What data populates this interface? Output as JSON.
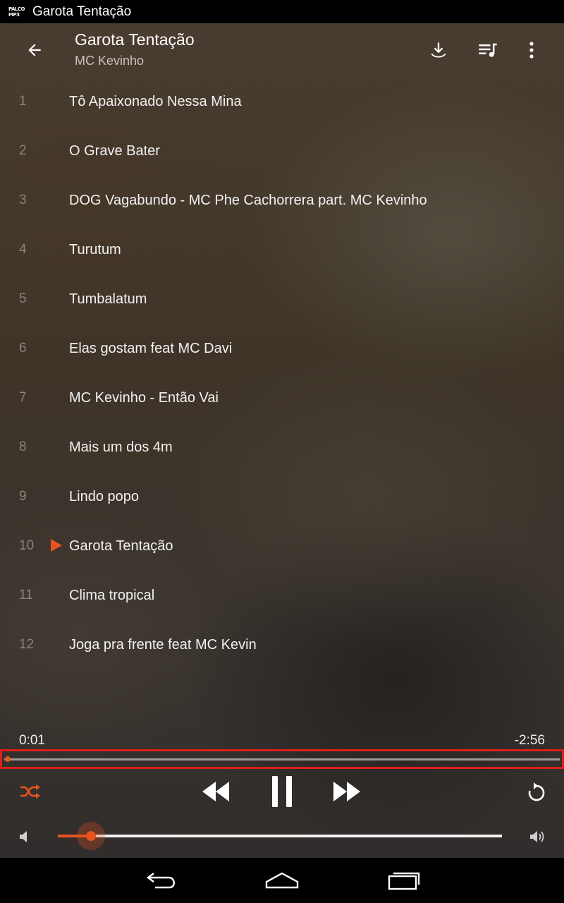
{
  "status_bar": {
    "app_icon_text": "PALCO MP3",
    "title": "Garota Tentação"
  },
  "header": {
    "title": "Garota Tentação",
    "subtitle": "MC Kevinho",
    "icons": [
      "back-arrow-icon",
      "download-icon",
      "queue-music-icon",
      "more-vert-icon"
    ]
  },
  "tracks": [
    {
      "num": "1",
      "title": "Tô Apaixonado Nessa Mina",
      "playing": false
    },
    {
      "num": "2",
      "title": "O Grave Bater",
      "playing": false
    },
    {
      "num": "3",
      "title": "DOG Vagabundo - MC Phe Cachorrera part. MC Kevinho",
      "playing": false
    },
    {
      "num": "4",
      "title": "Turutum",
      "playing": false
    },
    {
      "num": "5",
      "title": "Tumbalatum",
      "playing": false
    },
    {
      "num": "6",
      "title": "Elas gostam feat MC Davi",
      "playing": false
    },
    {
      "num": "7",
      "title": "MC Kevinho - Então Vai",
      "playing": false
    },
    {
      "num": "8",
      "title": "Mais um dos 4m",
      "playing": false
    },
    {
      "num": "9",
      "title": "Lindo popo",
      "playing": false
    },
    {
      "num": "10",
      "title": "Garota Tentação",
      "playing": true
    },
    {
      "num": "11",
      "title": "Clima tropical",
      "playing": false
    },
    {
      "num": "12",
      "title": "Joga pra frente feat MC Kevin",
      "playing": false
    }
  ],
  "player": {
    "elapsed": "0:01",
    "remaining": "-2:56",
    "seek_progress": 0.006,
    "volume_level": 0.075,
    "shuffle_active": true,
    "controls": [
      "shuffle-icon",
      "rewind-icon",
      "pause-icon",
      "fast-forward-icon",
      "repeat-icon",
      "volume-low-icon",
      "volume-high-icon"
    ]
  },
  "nav_bar": {
    "icons": [
      "nav-back-icon",
      "nav-home-icon",
      "nav-recents-icon"
    ]
  },
  "colors": {
    "accent": "#e8541f",
    "highlight_border": "#e01e1e",
    "status_bar_bg": "#000000",
    "track_number": "#8c857c"
  }
}
